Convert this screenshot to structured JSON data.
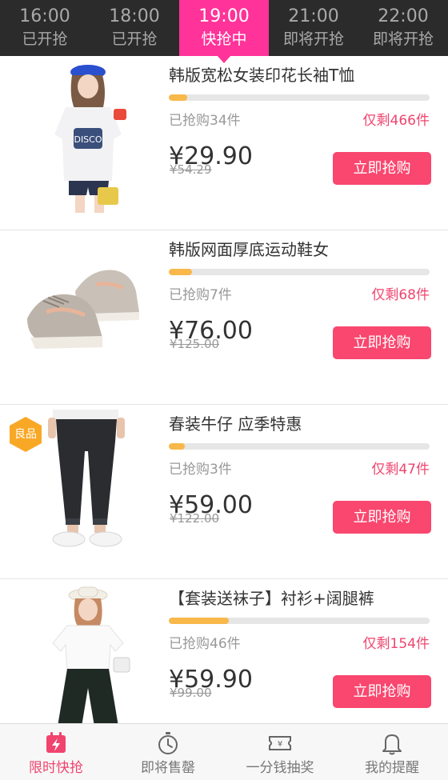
{
  "time_tabs": [
    {
      "time": "16:00",
      "status": "已开抢"
    },
    {
      "time": "18:00",
      "status": "已开抢"
    },
    {
      "time": "19:00",
      "status": "快抢中"
    },
    {
      "time": "21:00",
      "status": "即将开抢"
    },
    {
      "time": "22:00",
      "status": "即将开抢"
    }
  ],
  "active_tab_index": 2,
  "colors": {
    "accent": "#ff3399",
    "button": "#f9476f",
    "remain_text": "#f0446e",
    "progress_fill": "#f8b84a",
    "header_bg": "#2b2b2b"
  },
  "products": [
    {
      "title": "韩版宽松女装印花长袖T恤",
      "sold": "已抢购34件",
      "remaining": "仅剩466件",
      "price": "¥29.90",
      "original_price": "¥54.29",
      "button": "立即抢购",
      "progress_fraction": 0.07,
      "badge": null
    },
    {
      "title": "韩版网面厚底运动鞋女",
      "sold": "已抢购7件",
      "remaining": "仅剩68件",
      "price": "¥76.00",
      "original_price": "¥125.00",
      "button": "立即抢购",
      "progress_fraction": 0.09,
      "badge": null
    },
    {
      "title": "春装牛仔 应季特惠",
      "sold": "已抢购3件",
      "remaining": "仅剩47件",
      "price": "¥59.00",
      "original_price": "¥122.00",
      "button": "立即抢购",
      "progress_fraction": 0.06,
      "badge": "良品"
    },
    {
      "title": "【套装送袜子】衬衫+阔腿裤",
      "sold": "已抢购46件",
      "remaining": "仅剩154件",
      "price": "¥59.90",
      "original_price": "¥99.00",
      "button": "立即抢购",
      "progress_fraction": 0.23,
      "badge": null
    }
  ],
  "bottom_tabs": [
    {
      "label": "限时快抢",
      "icon": "flash-sale-icon"
    },
    {
      "label": "即将售罄",
      "icon": "stopwatch-icon"
    },
    {
      "label": "一分钱抽奖",
      "icon": "lottery-ticket-icon"
    },
    {
      "label": "我的提醒",
      "icon": "bell-icon"
    }
  ],
  "active_bottom_index": 0
}
